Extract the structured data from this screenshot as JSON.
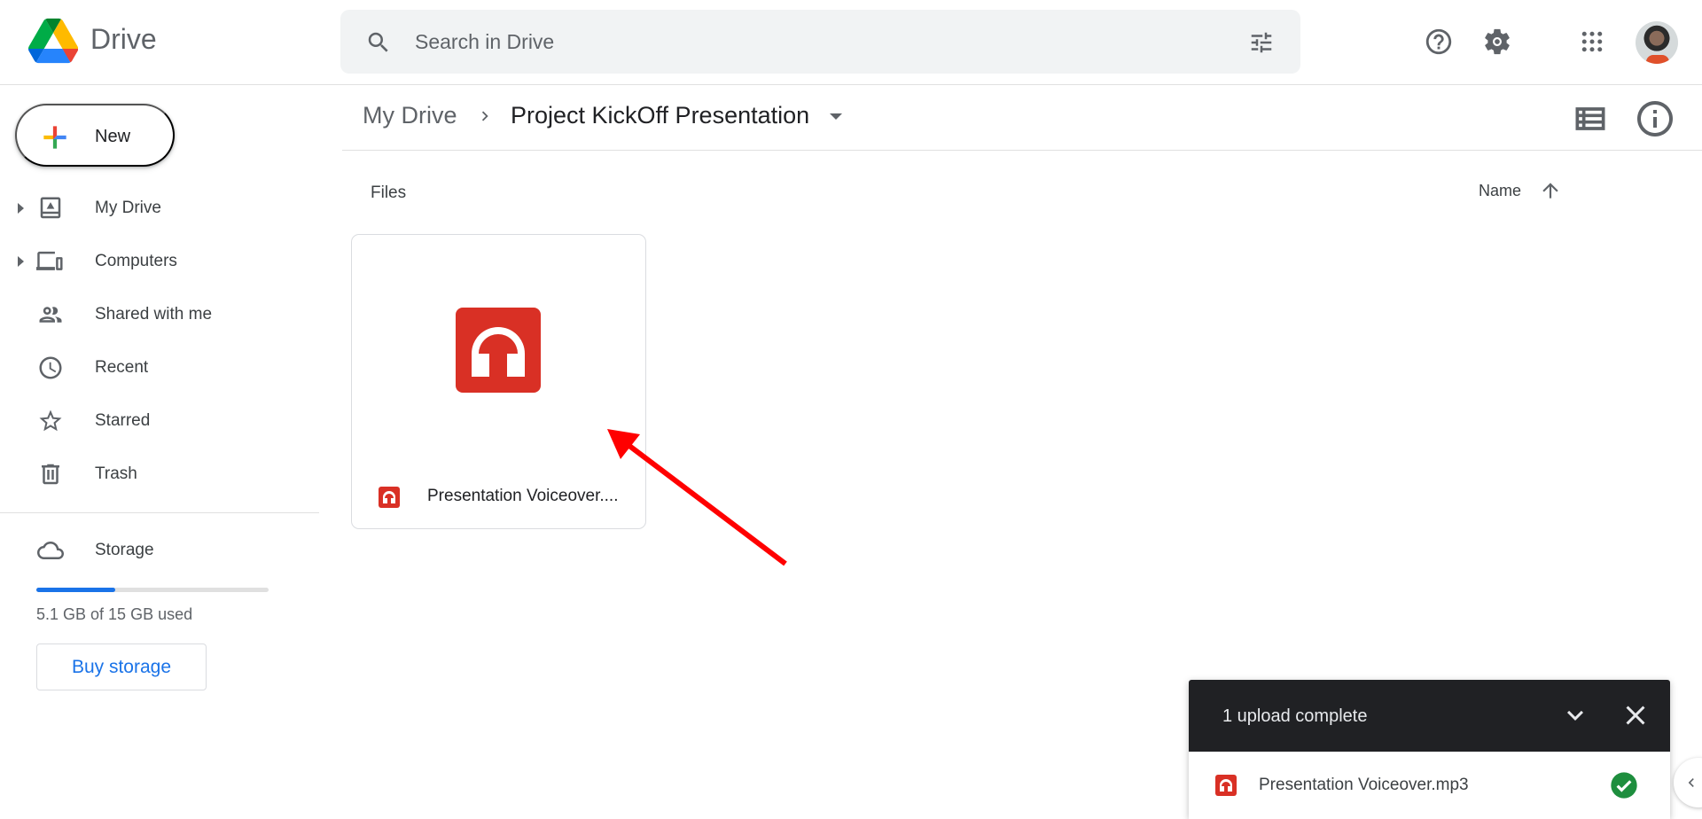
{
  "app": {
    "name": "Drive"
  },
  "header": {
    "search_placeholder": "Search in Drive",
    "search_value": "",
    "icons": [
      "search-icon",
      "search-options-icon",
      "help-icon",
      "settings-icon",
      "apps-grid-icon",
      "account-avatar"
    ]
  },
  "sidebar": {
    "new_label": "New",
    "items": [
      {
        "label": "My Drive",
        "icon": "my-drive-icon",
        "expandable": true
      },
      {
        "label": "Computers",
        "icon": "computers-icon",
        "expandable": true
      },
      {
        "label": "Shared with me",
        "icon": "shared-icon",
        "expandable": false
      },
      {
        "label": "Recent",
        "icon": "clock-icon",
        "expandable": false
      },
      {
        "label": "Starred",
        "icon": "star-icon",
        "expandable": false
      },
      {
        "label": "Trash",
        "icon": "trash-icon",
        "expandable": false
      }
    ],
    "storage": {
      "label": "Storage",
      "used_text": "5.1 GB of 15 GB used",
      "used_fraction": 0.34,
      "buy_label": "Buy storage"
    }
  },
  "breadcrumb": {
    "root": "My Drive",
    "current": "Project KickOff Presentation"
  },
  "main": {
    "section_label": "Files",
    "sort_label": "Name",
    "sort_direction": "ascending",
    "files": [
      {
        "name": "Presentation Voiceover....",
        "type": "audio",
        "icon": "audio-file-icon"
      }
    ]
  },
  "annotation": {
    "type": "arrow",
    "color": "#ff0000",
    "points_to": "file-card"
  },
  "upload_panel": {
    "title": "1 upload complete",
    "items": [
      {
        "name": "Presentation Voiceover.mp3",
        "status": "complete",
        "icon": "audio-file-icon"
      }
    ]
  },
  "colors": {
    "accent": "#1a73e8",
    "audio_red": "#d93025",
    "success_green": "#1e8e3e",
    "panel_dark": "#202124"
  }
}
